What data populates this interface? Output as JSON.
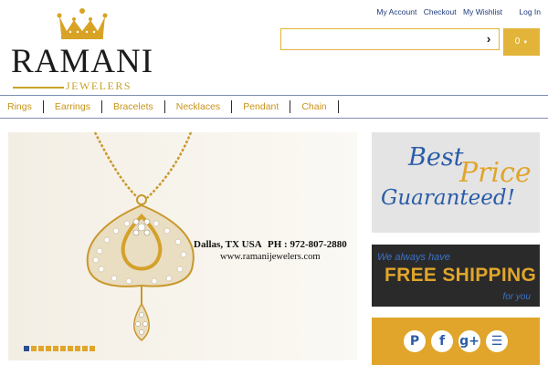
{
  "brand": {
    "name": "RAMANI",
    "subtitle": "JEWELERS"
  },
  "top_links": [
    "My Account",
    "Checkout",
    "My Wishlist",
    "Log In"
  ],
  "search": {
    "value": "",
    "go_icon": "chevron-right-icon"
  },
  "cart": {
    "count": "0"
  },
  "nav": [
    "Rings",
    "Earrings",
    "Bracelets",
    "Necklaces",
    "Pendant",
    "Chain"
  ],
  "banner": {
    "city": "Dallas, TX USA",
    "phone": "PH : 972-807-2880",
    "website": "www.ramanijewelers.com",
    "slides_total": 10,
    "slide_active": 1
  },
  "promo_price": {
    "line1": "Best",
    "line2": "Price",
    "line3": "Guaranteed!"
  },
  "promo_shipping": {
    "line1": "We always have",
    "line2": "FREE SHIPPING",
    "line3": "for you"
  },
  "social": [
    {
      "icon": "pinterest-icon",
      "glyph": "P"
    },
    {
      "icon": "facebook-icon",
      "glyph": "f"
    },
    {
      "icon": "google-plus-icon",
      "glyph": "g+"
    },
    {
      "icon": "rss-icon",
      "glyph": "☰"
    }
  ],
  "colors": {
    "gold": "#e0a52a",
    "blue": "#2a5ca8",
    "dark": "#2a2a2a"
  }
}
